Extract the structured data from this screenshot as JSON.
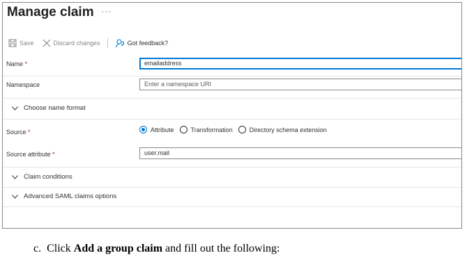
{
  "panel": {
    "title": "Manage claim",
    "more_label": "···"
  },
  "toolbar": {
    "save_label": "Save",
    "discard_label": "Discard changes",
    "feedback_label": "Got feedback?"
  },
  "form": {
    "name": {
      "label": "Name",
      "required_mark": "*",
      "value": "emailaddress"
    },
    "namespace": {
      "label": "Namespace",
      "placeholder": "Enter a namespace URI"
    },
    "name_format_section": "Choose name format",
    "source": {
      "label": "Source",
      "required_mark": "*",
      "options": [
        "Attribute",
        "Transformation",
        "Directory schema extension"
      ],
      "selected": "Attribute"
    },
    "source_attribute": {
      "label": "Source attribute",
      "required_mark": "*",
      "value": "user.mail"
    },
    "claim_conditions_section": "Claim conditions",
    "advanced_saml_section": "Advanced SAML claims options"
  },
  "instruction": {
    "prefix": "c.  Click ",
    "bold": "Add a group claim",
    "suffix": " and fill out the following:"
  },
  "colors": {
    "accent": "#0078d4",
    "required": "#a4262c",
    "border": "#8a8886"
  }
}
